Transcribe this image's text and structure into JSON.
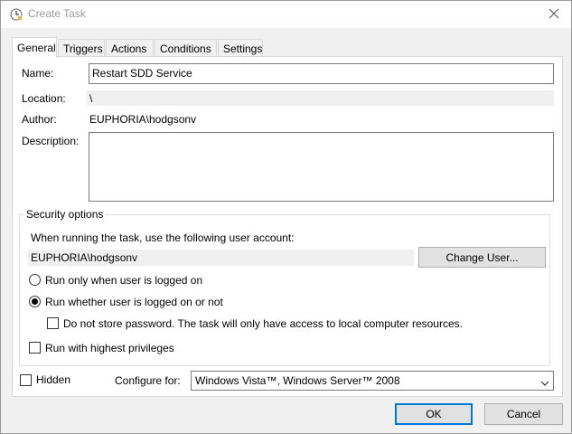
{
  "window": {
    "title": "Create Task"
  },
  "tabs": [
    {
      "label": "General"
    },
    {
      "label": "Triggers"
    },
    {
      "label": "Actions"
    },
    {
      "label": "Conditions"
    },
    {
      "label": "Settings"
    }
  ],
  "general": {
    "name_label": "Name:",
    "name_value": "Restart SDD Service",
    "location_label": "Location:",
    "location_value": "\\",
    "author_label": "Author:",
    "author_value": "EUPHORIA\\hodgsonv",
    "description_label": "Description:",
    "description_value": ""
  },
  "security": {
    "legend": "Security options",
    "account_prompt": "When running the task, use the following user account:",
    "account_value": "EUPHORIA\\hodgsonv",
    "change_user_label": "Change User...",
    "radio_logged_on_label": "Run only when user is logged on",
    "radio_logged_on_checked": false,
    "radio_whether_label": "Run whether user is logged on or not",
    "radio_whether_checked": true,
    "no_store_password_label": "Do not store password.  The task will only have access to local computer resources.",
    "no_store_password_checked": false,
    "highest_privileges_label": "Run with highest privileges",
    "highest_privileges_checked": false
  },
  "footer": {
    "hidden_label": "Hidden",
    "hidden_checked": false,
    "configure_for_label": "Configure for:",
    "configure_for_value": "Windows Vista™, Windows Server™ 2008"
  },
  "buttons": {
    "ok_label": "OK",
    "cancel_label": "Cancel"
  },
  "colors": {
    "accent": "#0078d7",
    "window_bg": "#f0f0f0",
    "panel_bg": "#ffffff"
  }
}
